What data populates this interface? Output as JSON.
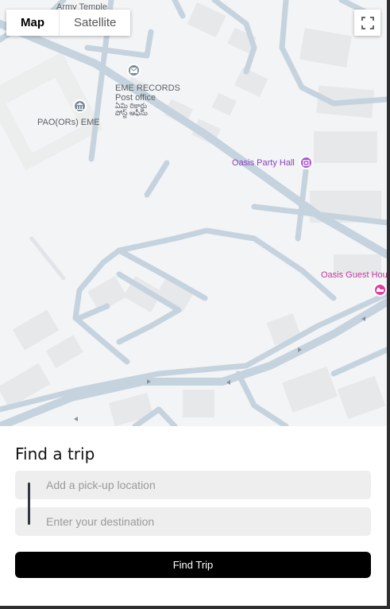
{
  "map": {
    "type_control": {
      "map_label": "Map",
      "satellite_label": "Satellite",
      "selected": "Map"
    },
    "fullscreen_icon": "fullscreen-icon",
    "labels": {
      "army_temple": "Army Temple",
      "eme_records_line1": "EME RECORDS",
      "eme_records_line2": "Post office",
      "eme_records_telugu1": "ఏమి రికార్డు",
      "eme_records_telugu2": "పోస్ట్ ఆఫీసు",
      "pao": "PAO(ORs) EME",
      "oasis_party_hall": "Oasis Party Hall",
      "oasis_guest_house": "Oasis Guest House"
    },
    "colors": {
      "background": "#f3f4f6",
      "road": "#c5d3df",
      "building": "#e8e9eb",
      "purple_poi": "#a855d6",
      "pink_poi": "#e040a0",
      "gray_poi": "#7a8a99"
    }
  },
  "trip": {
    "title": "Find a trip",
    "pickup_placeholder": "Add a pick-up location",
    "pickup_value": "",
    "destination_placeholder": "Enter your destination",
    "destination_value": "",
    "find_button": "Find Trip"
  }
}
